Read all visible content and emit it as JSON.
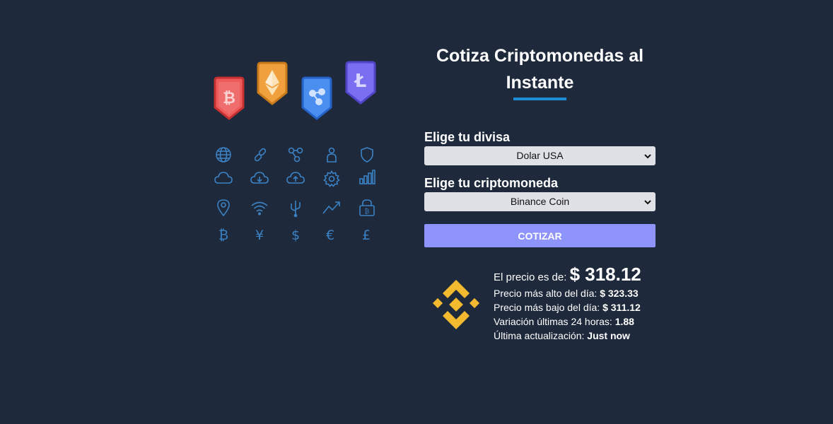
{
  "header": {
    "title_line1": "Cotiza Criptomonedas al",
    "title_line2": "Instante"
  },
  "form": {
    "currency_label": "Elige tu divisa",
    "currency_selected": "Dolar USA",
    "crypto_label": "Elige tu criptomoneda",
    "crypto_selected": "Binance Coin",
    "submit_label": "COTIZAR"
  },
  "result": {
    "price_label": "El precio es de:",
    "price_value": "$ 318.12",
    "high_label": "Precio más alto del día:",
    "high_value": "$ 323.33",
    "low_label": "Precio más bajo del día:",
    "low_value": "$ 311.12",
    "change_label": "Variación últimas 24 horas:",
    "change_value": "1.88",
    "updated_label": "Última actualización:",
    "updated_value": "Just now"
  },
  "icons": {
    "badges": [
      "bitcoin-icon",
      "ethereum-icon",
      "ripple-icon",
      "litecoin-icon"
    ],
    "grid": [
      "globe-icon",
      "link-icon",
      "network-icon",
      "user-icon",
      "shield-icon",
      "cloud-icon",
      "cloud-download-icon",
      "cloud-upload-icon",
      "gear-icon",
      "bar-chart-icon",
      "location-pin-icon",
      "wifi-icon",
      "usb-icon",
      "trend-up-icon",
      "lock-icon",
      "bitcoin-symbol-icon",
      "yen-icon",
      "dollar-icon",
      "euro-icon",
      "pound-icon"
    ]
  },
  "colors": {
    "background": "#1e293b",
    "accent": "#1d8fd8",
    "button": "#8f94fb",
    "binance": "#f3ba2f",
    "icon_line": "#3b82c4"
  }
}
